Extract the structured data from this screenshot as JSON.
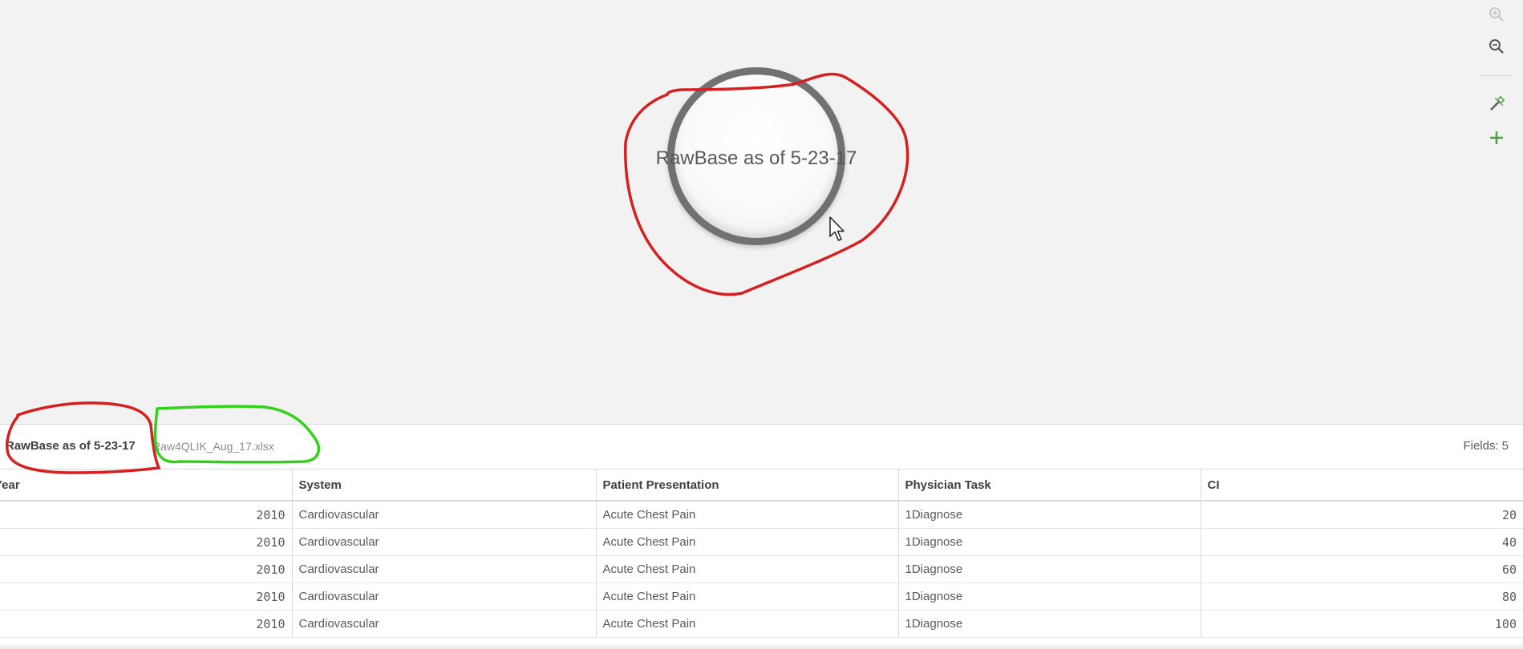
{
  "canvas": {
    "table_node_label": "RawBase as of 5-23-17",
    "toolbar": {
      "icons": [
        "zoom-in-icon",
        "zoom-out-icon",
        "magic-wand-icon",
        "add-icon"
      ],
      "accent": "#52a243",
      "icon_color": "#595959"
    }
  },
  "preview": {
    "table_name": "RawBase as of 5-23-17",
    "source_file": "Raw4QLIK_Aug_17.xlsx",
    "fields_label": "Fields:",
    "fields_count": "5",
    "columns": [
      "Year",
      "System",
      "Patient Presentation",
      "Physician Task",
      "CI"
    ],
    "rows": [
      [
        "2010",
        "Cardiovascular",
        "Acute Chest Pain",
        "1Diagnose",
        "20"
      ],
      [
        "2010",
        "Cardiovascular",
        "Acute Chest Pain",
        "1Diagnose",
        "40"
      ],
      [
        "2010",
        "Cardiovascular",
        "Acute Chest Pain",
        "1Diagnose",
        "60"
      ],
      [
        "2010",
        "Cardiovascular",
        "Acute Chest Pain",
        "1Diagnose",
        "80"
      ],
      [
        "2010",
        "Cardiovascular",
        "Acute Chest Pain",
        "1Diagnose",
        "100"
      ]
    ]
  },
  "annotations": {
    "red": "#d42020",
    "green": "#33d11c"
  }
}
